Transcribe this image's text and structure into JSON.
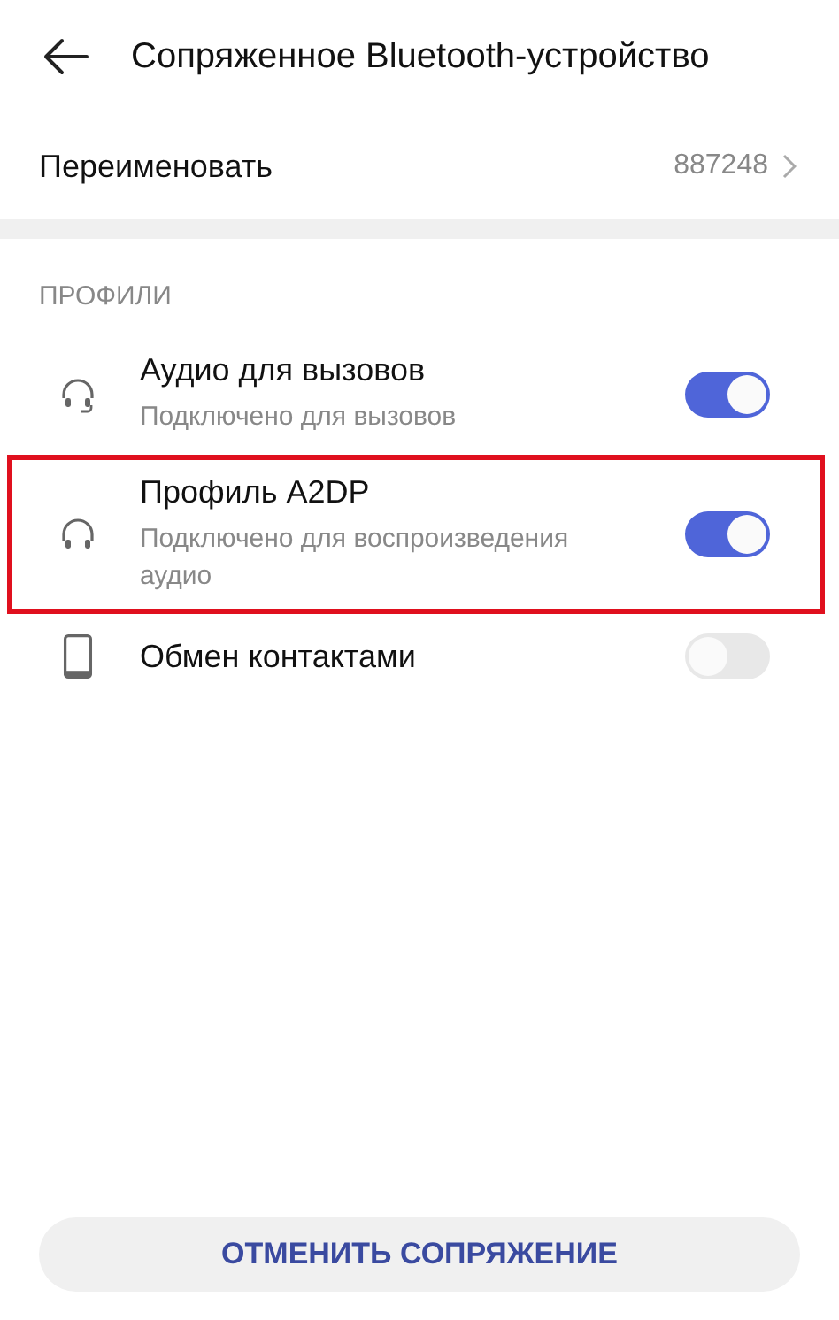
{
  "header": {
    "title": "Сопряженное Bluetooth-устройство"
  },
  "rename": {
    "label": "Переименовать",
    "value": "887248"
  },
  "section": {
    "title": "ПРОФИЛИ"
  },
  "profiles": [
    {
      "kind": "headset",
      "title": "Аудио для вызовов",
      "subtitle": "Подключено для вызовов",
      "on": true,
      "highlighted": false
    },
    {
      "kind": "headphones",
      "title": "Профиль A2DP",
      "subtitle": "Подключено для воспроизведения аудио",
      "on": true,
      "highlighted": true
    },
    {
      "kind": "phone",
      "title": "Обмен контактами",
      "on": false,
      "highlighted": false
    }
  ],
  "unpair_button": "ОТМЕНИТЬ СОПРЯЖЕНИЕ"
}
